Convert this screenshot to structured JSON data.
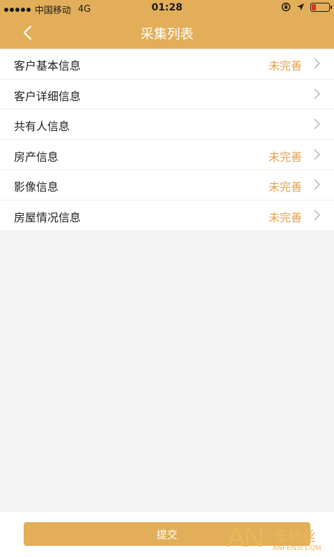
{
  "status_bar": {
    "carrier": "中国移动",
    "network": "4G",
    "time": "01:28"
  },
  "header": {
    "title": "采集列表"
  },
  "list": [
    {
      "label": "客户基本信息",
      "status": "未完善"
    },
    {
      "label": "客户详细信息",
      "status": ""
    },
    {
      "label": "共有人信息",
      "status": ""
    },
    {
      "label": "房产信息",
      "status": "未完善"
    },
    {
      "label": "影像信息",
      "status": "未完善"
    },
    {
      "label": "房屋情况信息",
      "status": "未完善"
    }
  ],
  "footer": {
    "submit_label": "提交"
  },
  "watermark": {
    "logo": "AN",
    "cn": "安粉丝",
    "en": "ANFENSI.COM"
  },
  "colors": {
    "accent": "#e2ae59",
    "status_text": "#e0a24b"
  }
}
